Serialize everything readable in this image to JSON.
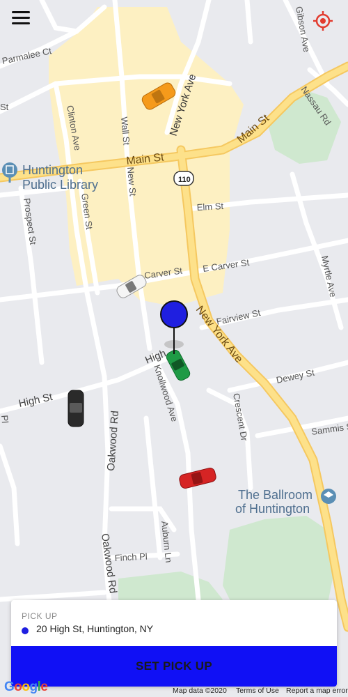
{
  "map": {
    "street_labels": {
      "gibson_ave": "Gibson Ave",
      "parmalee_ct": "Parmalee Ct",
      "nassau_rd": "Nassau Rd",
      "new_york_ave_north": "New York Ave",
      "clinton_ave": "Clinton Ave",
      "wall_st": "Wall St",
      "new_st": "New St",
      "main_st_west": "Main St",
      "main_st_east": "Main St",
      "route_110": "110",
      "green_st": "Green St",
      "prospect_st": "Prospect St",
      "elm_st": "Elm St",
      "carver_st": "Carver St",
      "e_carver_st": "E Carver St",
      "myrtle_ave": "Myrtle Ave",
      "fairview_st": "Fairview St",
      "new_york_ave_south": "New York Ave",
      "high_st_center": "High",
      "high_st_west": "High St",
      "knollwood_ave": "Knollwood Ave",
      "crescent_dr": "Crescent Dr",
      "dewey_st": "Dewey St",
      "sammis_st": "Sammis St",
      "oakwood_rd_north": "Oakwood Rd",
      "oakwood_rd_south": "Oakwood Rd",
      "auburn_ln": "Auburn Ln",
      "finch_pl": "Finch Pl",
      "pl_edge": "Pl",
      "st_edge": "St"
    },
    "pois": {
      "library_line1": "Huntington",
      "library_line2": "Public Library",
      "ballroom_line1": "The Ballroom",
      "ballroom_line2": "of Huntington"
    },
    "pin_color": "#1f1fe0",
    "car_colors": [
      "#f59a1b",
      "#f2f2f2",
      "#1e9a45",
      "#2a2a2a",
      "#d62424"
    ]
  },
  "top_bar": {
    "menu_icon": "hamburger-menu-icon",
    "locate_icon": "crosshair-locate-icon",
    "locate_color": "#e23b2e"
  },
  "pickup_card": {
    "label": "PICK UP",
    "address": "20 High St, Huntington, NY",
    "dot_color": "#1f1fe0",
    "button_label": "SET PICK UP",
    "button_color": "#1010f5"
  },
  "footer": {
    "logo": "Google",
    "map_data": "Map data ©2020",
    "terms": "Terms of Use",
    "report": "Report a map error"
  }
}
